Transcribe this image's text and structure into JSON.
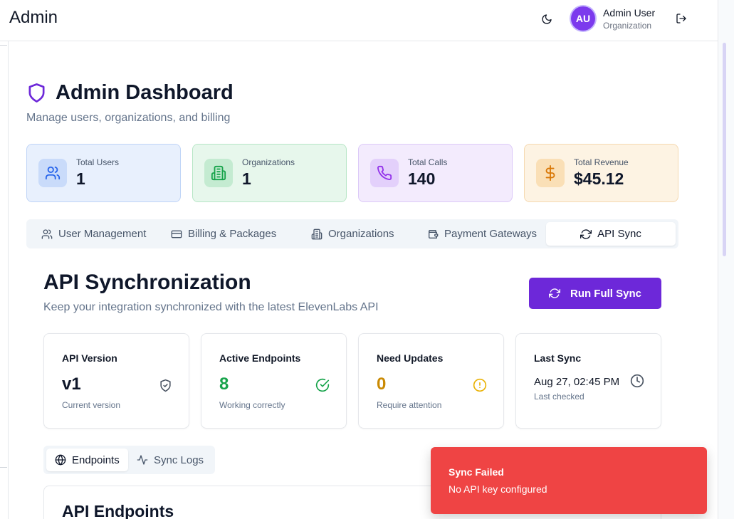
{
  "header": {
    "app_title": "Admin",
    "user_initials": "AU",
    "user_name": "Admin User",
    "user_org": "Organization"
  },
  "page": {
    "title": "Admin Dashboard",
    "subtitle": "Manage users, organizations, and billing"
  },
  "stats": [
    {
      "label": "Total Users",
      "value": "1",
      "icon": "users-icon",
      "color": "#2563eb"
    },
    {
      "label": "Organizations",
      "value": "1",
      "icon": "building-icon",
      "color": "#16a34a"
    },
    {
      "label": "Total Calls",
      "value": "140",
      "icon": "phone-icon",
      "color": "#9333ea"
    },
    {
      "label": "Total Revenue",
      "value": "$45.12",
      "icon": "dollar-icon",
      "color": "#d97706"
    }
  ],
  "main_tabs": [
    {
      "label": "User Management",
      "icon": "users-icon",
      "active": false
    },
    {
      "label": "Billing & Packages",
      "icon": "credit-card-icon",
      "active": false
    },
    {
      "label": "Organizations",
      "icon": "building-icon",
      "active": false
    },
    {
      "label": "Payment Gateways",
      "icon": "wallet-icon",
      "active": false
    },
    {
      "label": "API Sync",
      "icon": "refresh-icon",
      "active": true
    }
  ],
  "api_sync": {
    "title": "API Synchronization",
    "subtitle": "Keep your integration synchronized with the latest ElevenLabs API",
    "run_button": "Run Full Sync",
    "cards": {
      "version": {
        "title": "API Version",
        "value": "v1",
        "caption": "Current version"
      },
      "active": {
        "title": "Active Endpoints",
        "value": "8",
        "caption": "Working correctly"
      },
      "updates": {
        "title": "Need Updates",
        "value": "0",
        "caption": "Require attention"
      },
      "last_sync": {
        "title": "Last Sync",
        "value": "Aug 27, 02:45 PM",
        "caption": "Last checked"
      }
    },
    "sub_tabs": [
      {
        "label": "Endpoints",
        "active": true
      },
      {
        "label": "Sync Logs",
        "active": false
      }
    ],
    "endpoints_title": "API Endpoints"
  },
  "toast": {
    "title": "Sync Failed",
    "message": "No API key configured"
  },
  "colors": {
    "accent": "#6d28d9",
    "success": "#16a34a",
    "warning": "#ca8a04",
    "error": "#ef4444"
  }
}
